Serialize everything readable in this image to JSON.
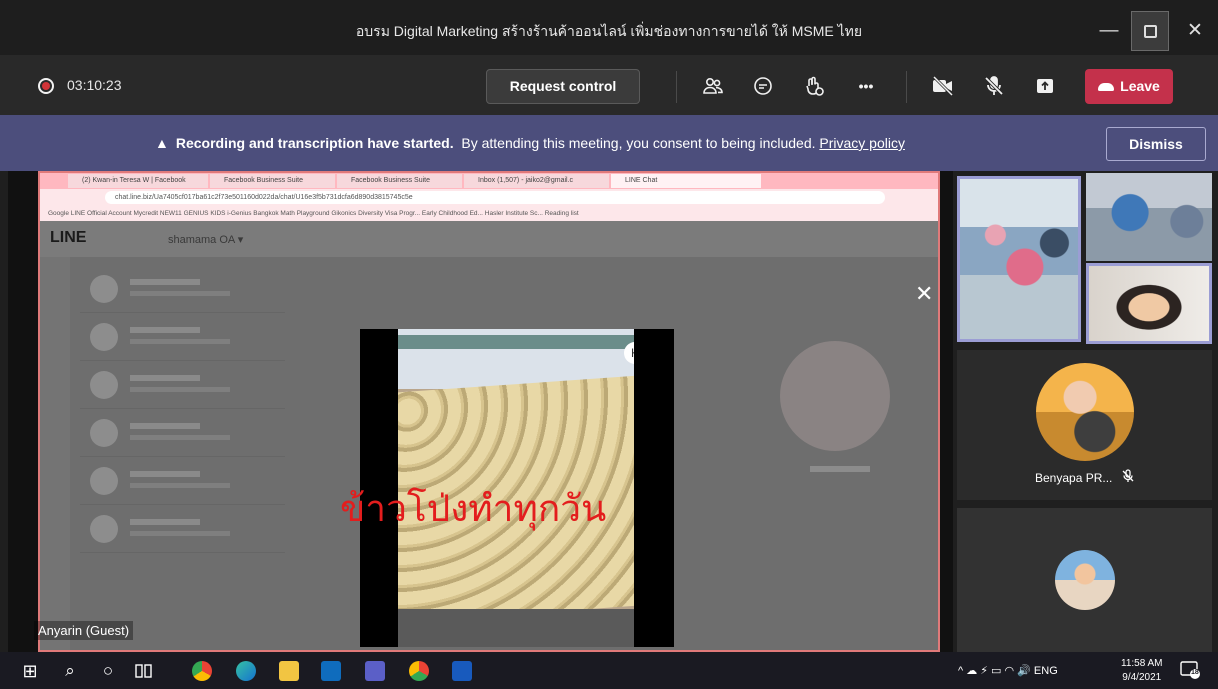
{
  "window": {
    "title": "อบรม Digital Marketing สร้างร้านค้าออนไลน์ เพิ่มช่องทางการขายได้ ให้ MSME ไทย",
    "minimize_glyph": "—",
    "close_glyph": "✕"
  },
  "toolbar": {
    "recording_time": "03:10:23",
    "request_control_label": "Request control",
    "more_glyph": "•••",
    "leave_label": "Leave",
    "icons": [
      "people-icon",
      "chat-icon",
      "reactions-icon",
      "more-icon",
      "camera-off-icon",
      "mic-off-icon",
      "share-icon",
      "phone-icon"
    ]
  },
  "banner": {
    "bold_text": "Recording and transcription have started.",
    "text": "By attending this meeting, you consent to being included.",
    "link_text": "Privacy policy",
    "dismiss_label": "Dismiss",
    "warning_glyph": "▲"
  },
  "shared_screen": {
    "browser_tabs": [
      "(2) Kwan-in Teresa W | Facebook",
      "Facebook Business Suite",
      "Facebook Business Suite",
      "Inbox (1,507) - jaiko2@gmail.c",
      "LINE Chat"
    ],
    "address": "chat.line.biz/Ua7405cf017ba61c2f73e501160d022da/chat/U16e3f5b731dcfa6d890d3815745c5e",
    "bookmarks": "Google   LINE Official Account   Mycredit   NEW11 GENIUS KIDS   i-Genius Bangkok   Math Playground   Gikonics   Diversity Visa Progr...   Early Childhood Ed...   Hasler Institute Sc...   Reading list",
    "app_logo": "LINE",
    "account_name": "shamama OA ▾",
    "video_caption": "ข้าวโป่งทำทุกวัน",
    "close_glyph": "✕",
    "video_logo": "K"
  },
  "participants": {
    "presenter_label": "Anyarin (Guest)",
    "benyapa_name": "Benyapa PR...",
    "mute_glyph": "🎙̸"
  },
  "taskbar": {
    "start_glyph": "⊞",
    "search_glyph": "⌕",
    "cortana_glyph": "○",
    "systray": "^  ☁  ⚡  ▭  ◠  🔊  ENG",
    "time": "11:58 AM",
    "date": "9/4/2021",
    "notification_count": "18"
  },
  "colors": {
    "leave": "#c4314b",
    "banner": "#4c4e7c",
    "active_speaker_border": "#9b9dd4",
    "recording_dot": "#d13438"
  }
}
